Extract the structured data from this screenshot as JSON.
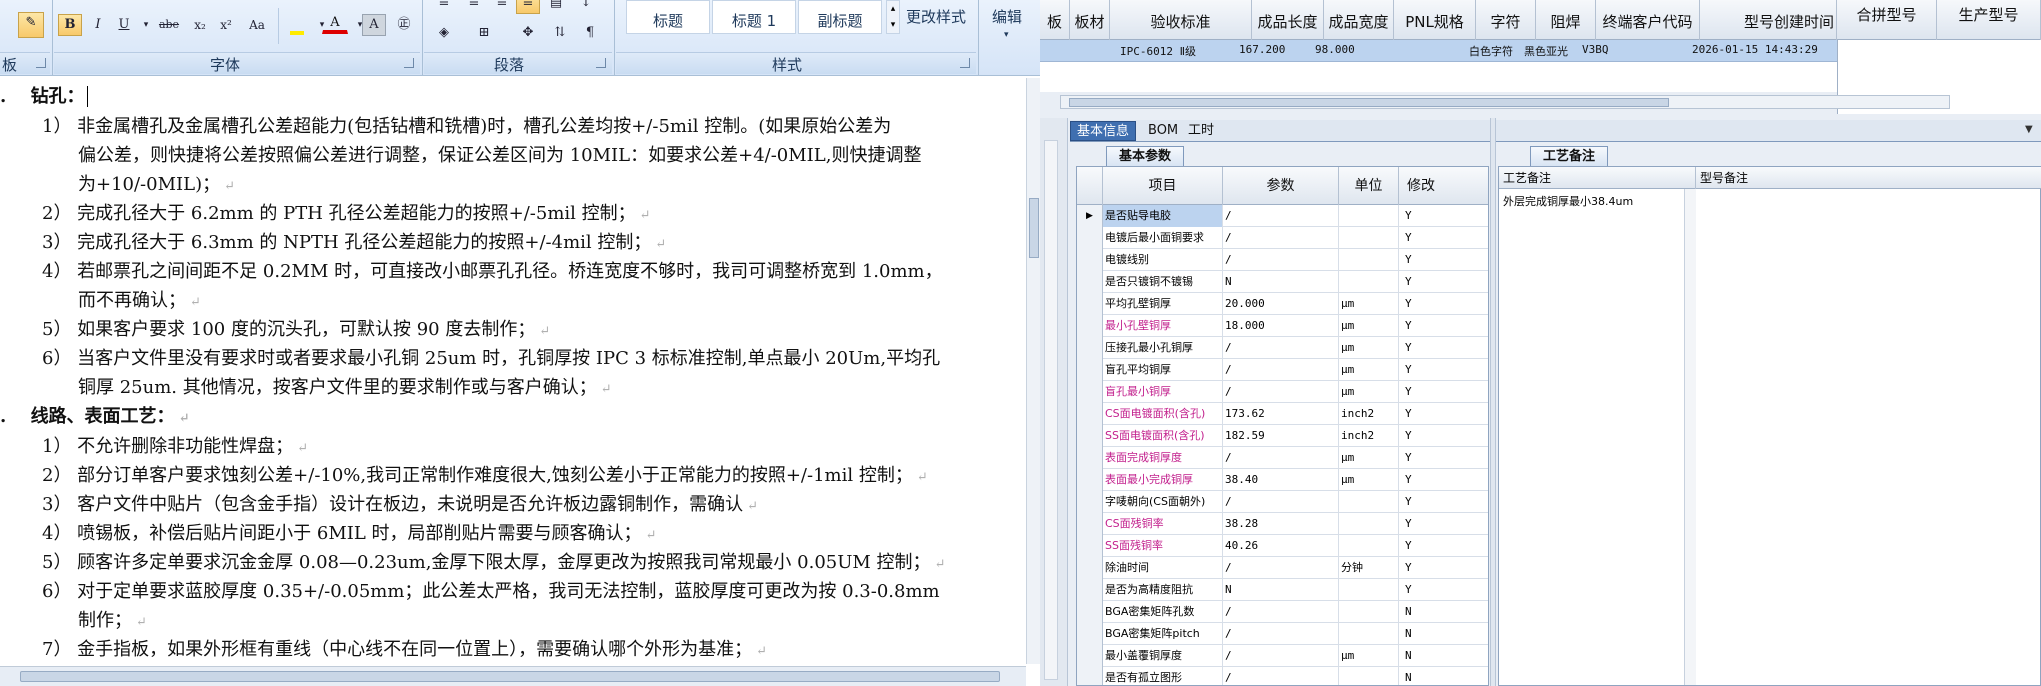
{
  "word": {
    "ribbon": {
      "font_group": "字体",
      "paragraph_group": "段落",
      "styles_group": "样式",
      "clipboard_group": "板",
      "bold": "B",
      "italic": "I",
      "underline": "U",
      "strike": "abe",
      "subscript": "x₂",
      "superscript": "x²",
      "font_case": "Aa",
      "font_color": "A",
      "char_shade": "A",
      "char_border": "㊣",
      "style_1": "标题",
      "style_2": "标题 1",
      "style_3": "副标题",
      "change_styles": "更改样式",
      "edit": "编辑"
    },
    "doc": {
      "h1": "钻孔：",
      "h1_num": ".",
      "h2": "线路、表面工艺：",
      "h2_num": ".",
      "lines": [
        "1） 非金属槽孔及金属槽孔公差超能力(包括钻槽和铣槽)时，槽孔公差均按+/-5mil 控制。(如果原始公差为",
        "偏公差，则快捷将公差按照偏公差进行调整，保证公差区间为 10MIL：如要求公差+4/-0MIL,则快捷调整",
        "为+10/-0MIL)；",
        "2） 完成孔径大于 6.2mm 的 PTH 孔径公差超能力的按照+/-5mil 控制；",
        "3） 完成孔径大于 6.3mm 的 NPTH 孔径公差超能力的按照+/-4mil 控制；",
        "4） 若邮票孔之间间距不足 0.2MM 时，可直接改小邮票孔孔径。桥连宽度不够时，我司可调整桥宽到 1.0mm，",
        "而不再确认；",
        "5） 如果客户要求 100 度的沉头孔，可默认按 90 度去制作；",
        "6） 当客户文件里没有要求时或者要求最小孔铜 25um 时，孔铜厚按 IPC 3 标标准控制,单点最小 20Um,平均孔",
        "铜厚 25um. 其他情况，按客户文件里的要求制作或与客户确认；",
        "1） 不允许删除非功能性焊盘；",
        "2） 部分订单客户要求蚀刻公差+/-10%,我司正常制作难度很大,蚀刻公差小于正常能力的按照+/-1mil 控制；",
        "3） 客户文件中贴片（包含金手指）设计在板边，未说明是否允许板边露铜制作，需确认",
        "4） 喷锡板，补偿后贴片间距小于 6MIL 时，局部削贴片需要与顾客确认；",
        "5） 顾客许多定单要求沉金金厚 0.08—0.23um,金厚下限太厚，金厚更改为按照我司常规最小 0.05UM 控制；",
        "6） 对于定单要求蓝胶厚度 0.35+/-0.05mm；此公差太严格，我司无法控制，蓝胶厚度可更改为按 0.3-0.8mm",
        "制作；",
        "7） 金手指板，如果外形框有重线（中心线不在同一位置上），需要确认哪个外形为基准；"
      ]
    }
  },
  "erp": {
    "grid_headers": [
      "板厚",
      "板材",
      "验收标准",
      "成品长度",
      "成品宽度",
      "PNL规格",
      "字符",
      "阻焊",
      "终端客户代码",
      "型号创建时间"
    ],
    "grid_row": {
      "standard": "IPC-6012 Ⅱ级",
      "length": "167.200",
      "width": "98.000",
      "char": "白色字符",
      "mask": "黑色亚光",
      "customer_code": "V3BQ",
      "created": "2026-01-15 14:43:29"
    },
    "right_headers": [
      "合拼型号",
      "生产型号"
    ],
    "tabs": [
      "基本信息",
      "BOM",
      "工时"
    ],
    "subtab_params": "基本参数",
    "subtab_remarks": "工艺备注",
    "param_headers": [
      "项目",
      "参数",
      "单位",
      "修改"
    ],
    "params": [
      {
        "item": "是否贴导电胶",
        "value": "/",
        "unit": "",
        "mod": "Y",
        "magenta": false
      },
      {
        "item": "电镀后最小面铜要求",
        "value": "/",
        "unit": "",
        "mod": "Y",
        "magenta": false
      },
      {
        "item": "电镀线别",
        "value": "/",
        "unit": "",
        "mod": "Y",
        "magenta": false
      },
      {
        "item": "是否只镀铜不镀锡",
        "value": "N",
        "unit": "",
        "mod": "Y",
        "magenta": false
      },
      {
        "item": "平均孔壁铜厚",
        "value": "20.000",
        "unit": "μm",
        "mod": "Y",
        "magenta": false
      },
      {
        "item": "最小孔壁铜厚",
        "value": "18.000",
        "unit": "μm",
        "mod": "Y",
        "magenta": true
      },
      {
        "item": "压接孔最小孔铜厚",
        "value": "/",
        "unit": "μm",
        "mod": "Y",
        "magenta": false
      },
      {
        "item": "盲孔平均铜厚",
        "value": "/",
        "unit": "μm",
        "mod": "Y",
        "magenta": false
      },
      {
        "item": "盲孔最小铜厚",
        "value": "/",
        "unit": "μm",
        "mod": "Y",
        "magenta": true
      },
      {
        "item": "CS面电镀面积(含孔)",
        "value": "173.62",
        "unit": "inch2",
        "mod": "Y",
        "magenta": true
      },
      {
        "item": "SS面电镀面积(含孔)",
        "value": "182.59",
        "unit": "inch2",
        "mod": "Y",
        "magenta": true
      },
      {
        "item": "表面完成铜厚度",
        "value": "/",
        "unit": "μm",
        "mod": "Y",
        "magenta": true
      },
      {
        "item": "表面最小完成铜厚",
        "value": "38.40",
        "unit": "μm",
        "mod": "Y",
        "magenta": true
      },
      {
        "item": "字唛朝向(CS面朝外)",
        "value": "/",
        "unit": "",
        "mod": "Y",
        "magenta": false
      },
      {
        "item": "CS面残铜率",
        "value": "38.28",
        "unit": "",
        "mod": "Y",
        "magenta": true
      },
      {
        "item": "SS面残铜率",
        "value": "40.26",
        "unit": "",
        "mod": "Y",
        "magenta": true
      },
      {
        "item": "除油时间",
        "value": "/",
        "unit": "分钟",
        "mod": "Y",
        "magenta": false
      },
      {
        "item": "是否为高精度阻抗",
        "value": "N",
        "unit": "",
        "mod": "Y",
        "magenta": false
      },
      {
        "item": "BGA密集矩阵孔数",
        "value": "/",
        "unit": "",
        "mod": "N",
        "magenta": false
      },
      {
        "item": "BGA密集矩阵pitch",
        "value": "/",
        "unit": "",
        "mod": "N",
        "magenta": false
      },
      {
        "item": "最小盖覆铜厚度",
        "value": "/",
        "unit": "μm",
        "mod": "N",
        "magenta": false
      },
      {
        "item": "是否有孤立图形",
        "value": "/",
        "unit": "",
        "mod": "N",
        "magenta": false
      }
    ],
    "remark_headers": [
      "工艺备注",
      "型号备注"
    ],
    "remark_text": "外层完成铜厚最小38.4um"
  }
}
